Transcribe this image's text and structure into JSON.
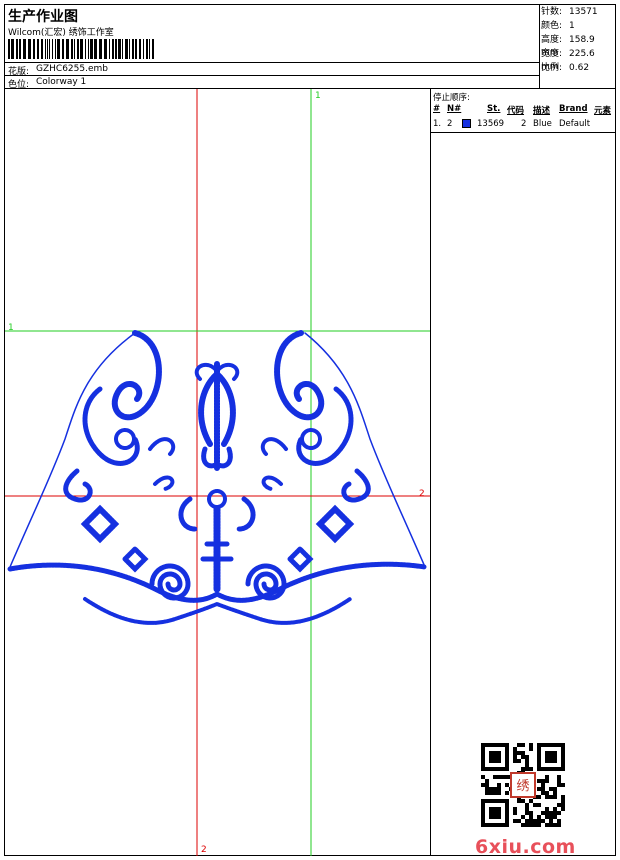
{
  "header": {
    "title": "生产作业图",
    "company": "Wilcom(汇宏) 绣饰工作室",
    "design_label": "花版:",
    "design_value": "GZHC6255.emb",
    "colorway_label": "色位:",
    "colorway_value": "Colorway 1"
  },
  "stats": [
    {
      "label": "针数:",
      "value": "13571"
    },
    {
      "label": "颜色:",
      "value": "1"
    },
    {
      "label": "高度:",
      "value": "158.9 mm"
    },
    {
      "label": "宽度:",
      "value": "225.6 mm"
    },
    {
      "label": "比例:",
      "value": "0.62"
    }
  ],
  "stop_sequence": {
    "title": "停止顺序:",
    "columns": [
      "#",
      "N#",
      "St.",
      "代码",
      "描述",
      "Brand",
      "元素"
    ],
    "rows": [
      {
        "index": "1.",
        "needle": "2",
        "stitches": "13569",
        "code": "2",
        "description": "Blue",
        "brand": "Default",
        "color": "#1530e0"
      }
    ]
  },
  "canvas": {
    "guide_labels": {
      "green_top": "1",
      "green_left": "1",
      "red_right": "2",
      "red_bottom": "2"
    },
    "colors": {
      "green": "#22cc22",
      "red": "#dd0000",
      "thread": "#1530e0"
    }
  },
  "watermark": "6xiu.com",
  "qr_stamp": "绣"
}
